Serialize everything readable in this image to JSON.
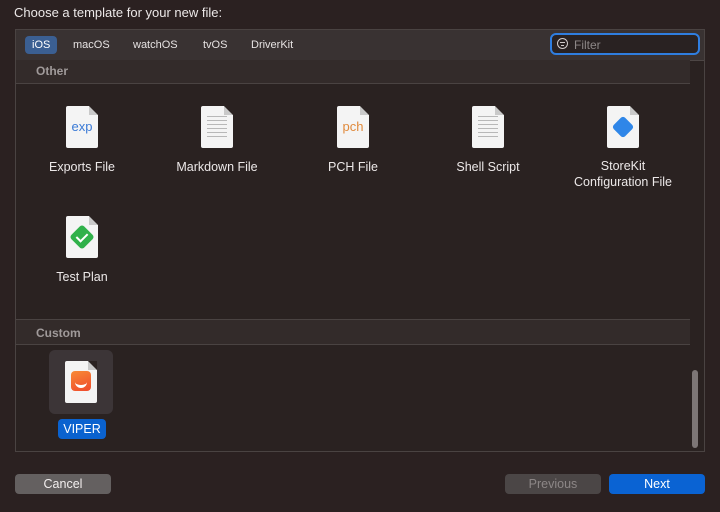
{
  "dialog": {
    "title": "Choose a template for your new file:"
  },
  "platform_tabs": [
    {
      "label": "iOS",
      "selected": true
    },
    {
      "label": "macOS",
      "selected": false
    },
    {
      "label": "watchOS",
      "selected": false
    },
    {
      "label": "tvOS",
      "selected": false
    },
    {
      "label": "DriverKit",
      "selected": false
    }
  ],
  "filter": {
    "placeholder": "Filter",
    "value": ""
  },
  "sections": {
    "other": {
      "header": "Other",
      "items": [
        {
          "label": "Exports File",
          "icon": "exports-file-icon",
          "ext": "exp"
        },
        {
          "label": "Markdown File",
          "icon": "markdown-file-icon"
        },
        {
          "label": "PCH File",
          "icon": "pch-file-icon",
          "ext": "pch"
        },
        {
          "label": "Shell Script",
          "icon": "shell-script-icon"
        },
        {
          "label": "StoreKit\nConfiguration File",
          "icon": "storekit-file-icon"
        },
        {
          "label": "Test Plan",
          "icon": "test-plan-icon"
        }
      ]
    },
    "custom": {
      "header": "Custom",
      "items": [
        {
          "label": "VIPER",
          "icon": "swift-file-icon",
          "selected": true
        }
      ]
    }
  },
  "buttons": {
    "cancel": "Cancel",
    "previous": "Previous",
    "next": "Next"
  },
  "colors": {
    "accent": "#0a63d3",
    "background": "#2b2121"
  }
}
